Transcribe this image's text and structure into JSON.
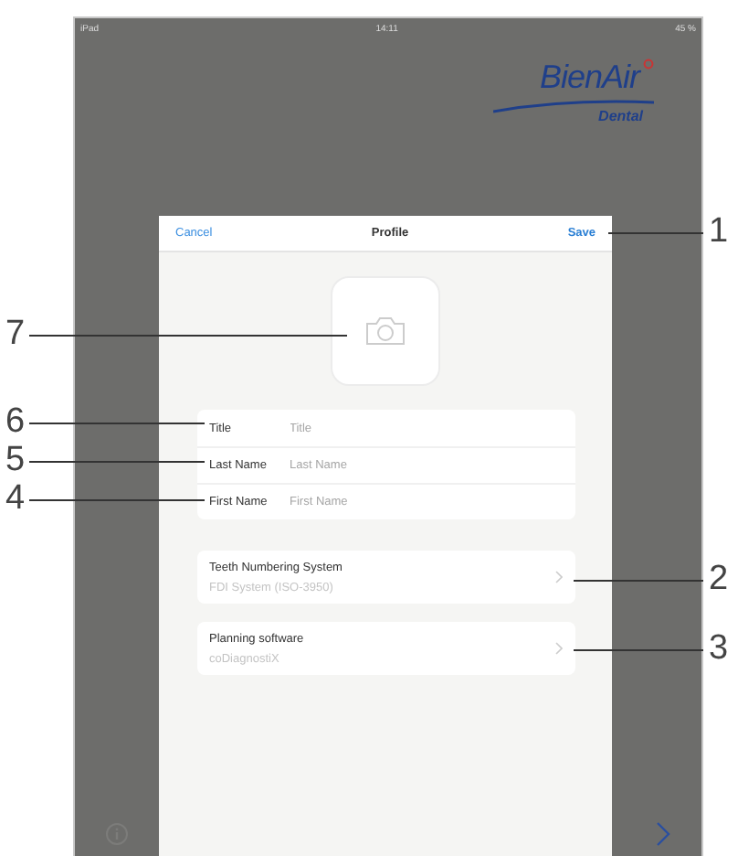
{
  "status_bar": {
    "device": "iPad",
    "time": "14:11",
    "battery": "45 %"
  },
  "logo": {
    "name": "BienAir",
    "tagline": "Dental"
  },
  "dialog": {
    "cancel": "Cancel",
    "title": "Profile",
    "save": "Save",
    "fields": [
      {
        "label": "Title",
        "placeholder": "Title"
      },
      {
        "label": "Last Name",
        "placeholder": "Last Name"
      },
      {
        "label": "First Name",
        "placeholder": "First Name"
      }
    ],
    "settings": [
      {
        "label": "Teeth Numbering System",
        "value": "FDI System (ISO-3950)"
      },
      {
        "label": "Planning software",
        "value": "coDiagnostiX"
      }
    ]
  },
  "callouts": [
    "1",
    "7",
    "6",
    "5",
    "4",
    "2",
    "3"
  ]
}
